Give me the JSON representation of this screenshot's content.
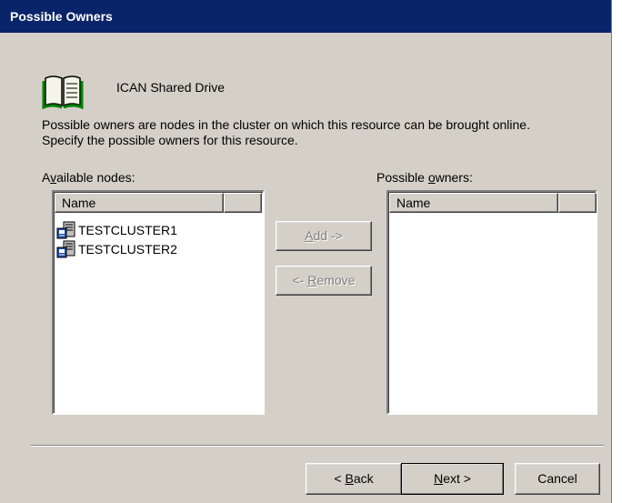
{
  "title": "Possible Owners",
  "resource": {
    "icon": "book-resource-icon",
    "name": "ICAN Shared Drive"
  },
  "description_line1": "Possible owners are nodes in the cluster on which this resource can be brought online.",
  "description_line2": "Specify the possible owners for this resource.",
  "available": {
    "label_pre": "A",
    "label_accel": "v",
    "label_post": "ailable nodes:",
    "column_name": "Name",
    "column_extra": "",
    "items": [
      {
        "label": "TESTCLUSTER1",
        "icon": "cluster-node-icon"
      },
      {
        "label": "TESTCLUSTER2",
        "icon": "cluster-node-icon"
      }
    ]
  },
  "owners": {
    "label_pre": "Possible ",
    "label_accel": "o",
    "label_post": "wners:",
    "column_name": "Name",
    "column_extra": "",
    "items": []
  },
  "buttons": {
    "add_accel": "A",
    "add_post": "dd ->",
    "remove_pre": "<- ",
    "remove_accel": "R",
    "remove_post": "emove",
    "back_pre": "< ",
    "back_accel": "B",
    "back_post": "ack",
    "next_accel": "N",
    "next_post": "ext >",
    "cancel": "Cancel"
  },
  "colors": {
    "titlebar": "#0a246a",
    "dialog_face": "#d4d0c8",
    "disabled_text": "#808080"
  }
}
